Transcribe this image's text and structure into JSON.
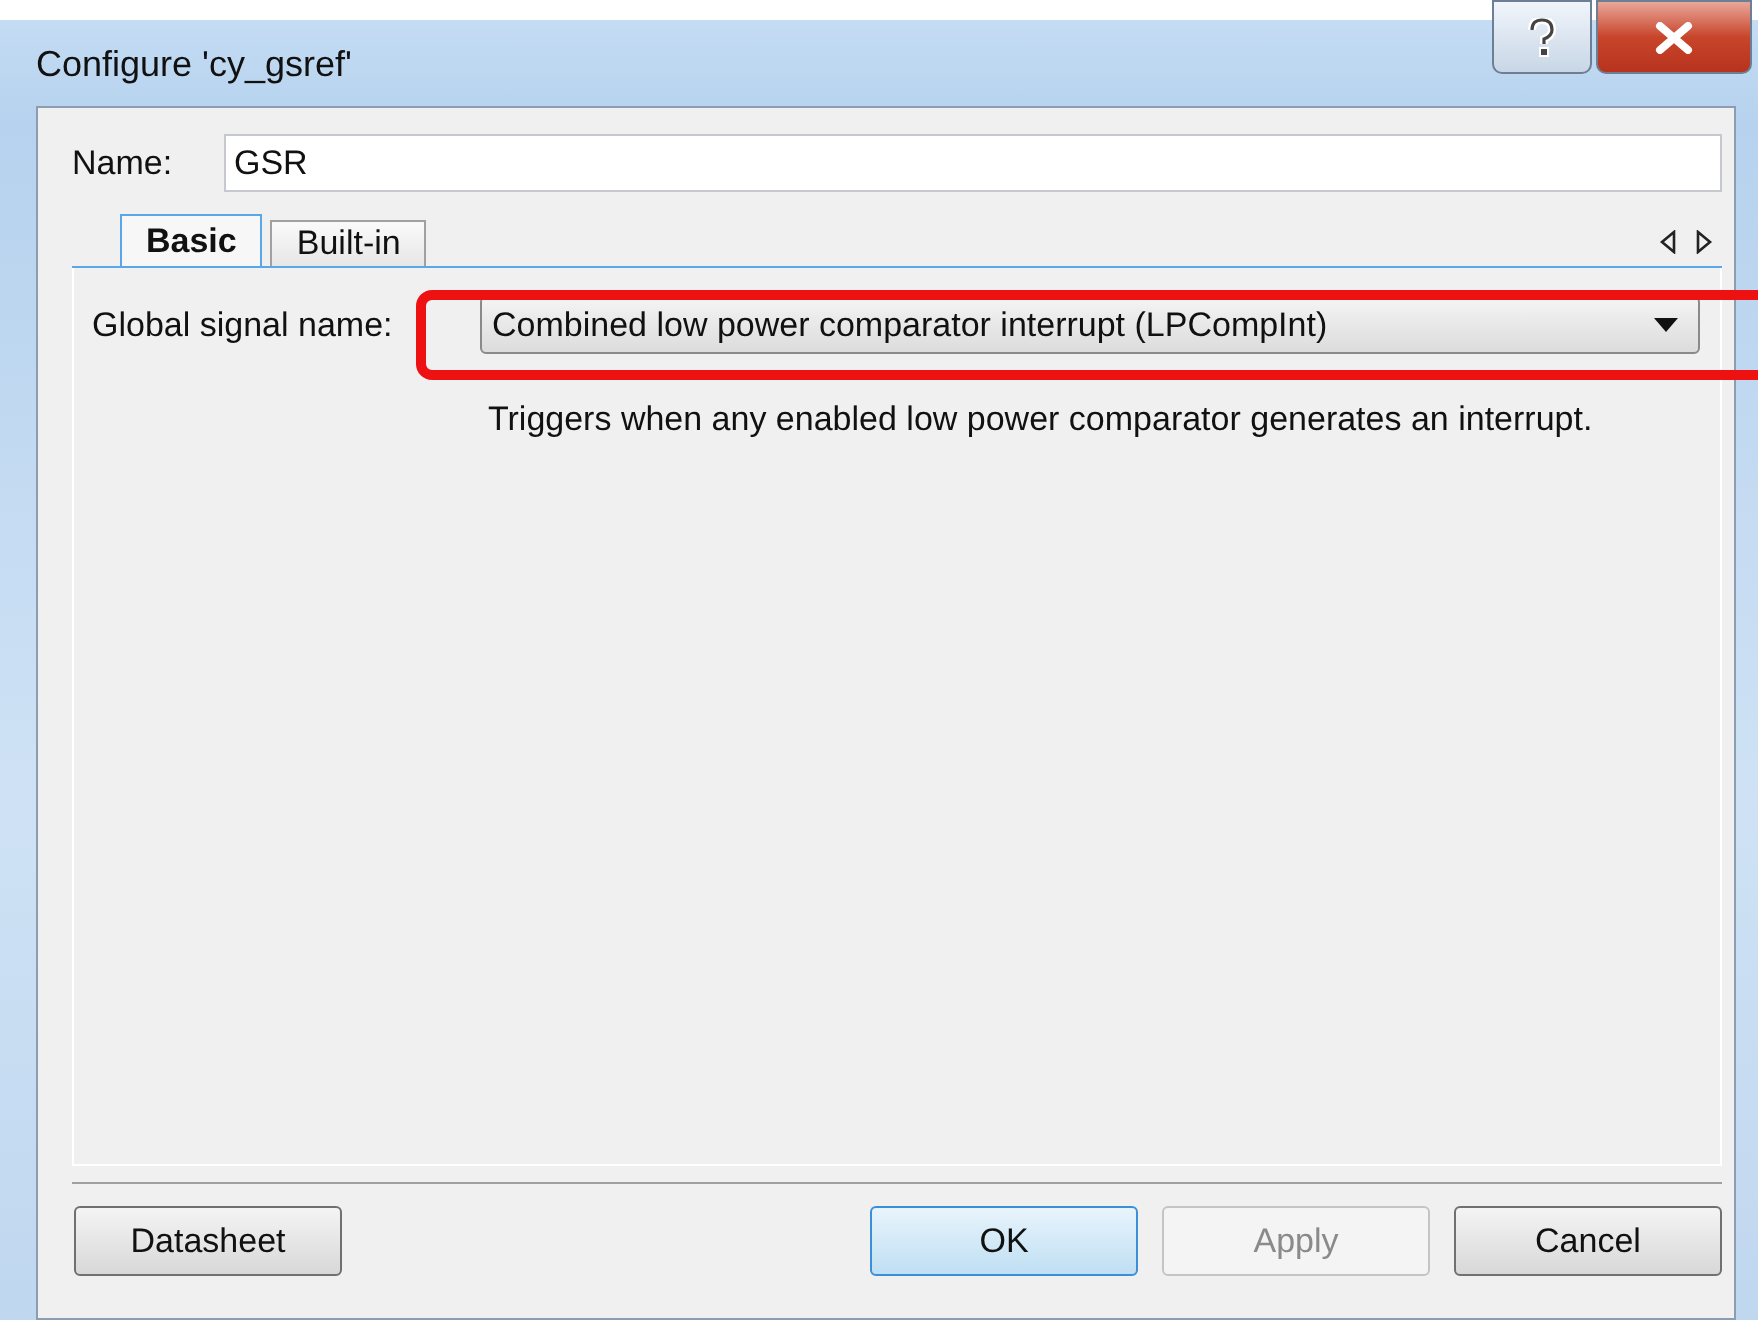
{
  "window": {
    "title": "Configure 'cy_gsref'"
  },
  "name_field": {
    "label": "Name:",
    "value": "GSR"
  },
  "tabs": [
    {
      "label": "Basic",
      "selected": true
    },
    {
      "label": "Built-in",
      "selected": false
    }
  ],
  "signal": {
    "label": "Global signal name:",
    "value": "Combined low power comparator interrupt (LPCompInt)",
    "description": "Triggers when any enabled low power comparator generates an interrupt."
  },
  "buttons": [
    {
      "label": "Datasheet",
      "default": false,
      "disabled": false
    },
    {
      "label": "OK",
      "default": true,
      "disabled": false
    },
    {
      "label": "Apply",
      "default": false,
      "disabled": true
    },
    {
      "label": "Cancel",
      "default": false,
      "disabled": false
    }
  ]
}
